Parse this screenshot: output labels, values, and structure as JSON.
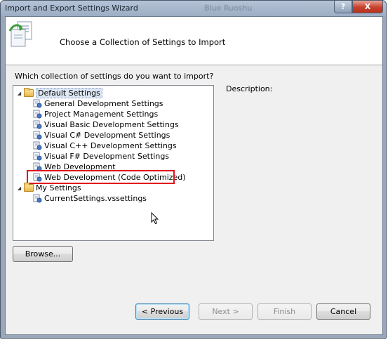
{
  "window": {
    "title": "Import and Export Settings Wizard",
    "background_title": "Blue Ruoshu",
    "help_label": "?",
    "close_label": "X"
  },
  "banner": {
    "title": "Choose a Collection of Settings to Import"
  },
  "question": "Which collection of settings do you want to import?",
  "tree": {
    "root_default": {
      "label": "Default Settings",
      "expanded": true,
      "items": [
        "General Development Settings",
        "Project Management Settings",
        "Visual Basic Development Settings",
        "Visual C# Development Settings",
        "Visual C++ Development Settings",
        "Visual F# Development Settings",
        "Web Development",
        "Web Development (Code Optimized)"
      ],
      "selected_item": "Web Development (Code Optimized)"
    },
    "root_my": {
      "label": "My Settings",
      "expanded": true,
      "items": [
        "CurrentSettings.vssettings"
      ]
    },
    "expander_glyph": "◢"
  },
  "description_label": "Description:",
  "buttons": {
    "browse": "Browse...",
    "previous": "< Previous",
    "next": "Next >",
    "finish": "Finish",
    "cancel": "Cancel"
  },
  "icons": {
    "banner": "settings-wizard-icon",
    "folder": "folder-icon",
    "settings_file": "settings-file-icon",
    "cursor": "mouse-cursor-icon"
  },
  "colors": {
    "highlight_border": "#e0141b",
    "titlebar": "#9cadc3",
    "close_button": "#c7412c"
  }
}
